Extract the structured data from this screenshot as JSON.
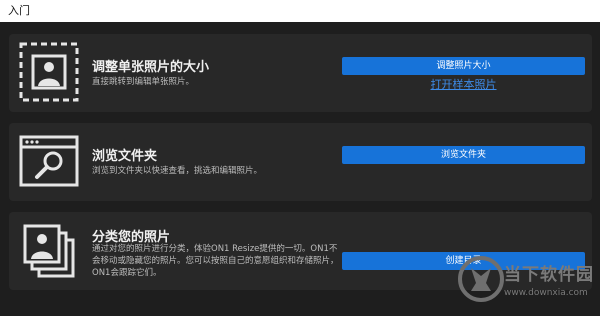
{
  "window": {
    "title": "入门"
  },
  "cards": [
    {
      "icon": "resize-photo-icon",
      "title": "调整单张照片的大小",
      "description": "直接跳转到编辑单张照片。",
      "button_label": "调整照片大小",
      "link_label": "打开样本照片"
    },
    {
      "icon": "browse-folder-icon",
      "title": "浏览文件夹",
      "description": "浏览到文件夹以快速查看，挑选和编辑照片。",
      "button_label": "浏览文件夹"
    },
    {
      "icon": "photo-stack-icon",
      "title": "分类您的照片",
      "description": "通过对您的照片进行分类，体验ON1 Resize提供的一切。ON1不会移动或隐藏您的照片。您可以按照自己的意愿组织和存储照片，ON1会跟踪它们。",
      "button_label": "创建目录"
    }
  ],
  "watermark": {
    "text": "当下软件园",
    "url": "www.downxia.com"
  },
  "colors": {
    "accent": "#1773d9",
    "background": "#1e1e1e",
    "card": "#282828",
    "link": "#3d8be8"
  }
}
